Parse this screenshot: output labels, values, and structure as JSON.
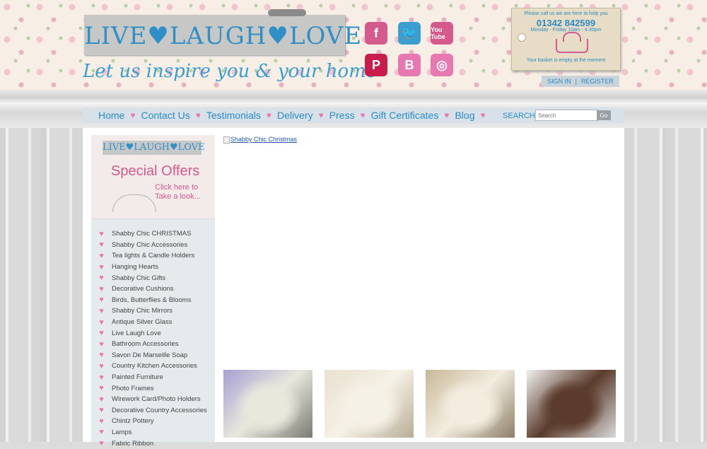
{
  "header": {
    "logo_text": "LIVE♥LAUGH♥LOVE",
    "tagline": "Let us inspire you & your home",
    "social": [
      {
        "name": "facebook-icon",
        "glyph": "f",
        "color": "#d45a8c"
      },
      {
        "name": "twitter-icon",
        "glyph": "🐦",
        "color": "#3a9fd0"
      },
      {
        "name": "youtube-icon",
        "glyph": "You Tube",
        "color": "#d45a8c"
      },
      {
        "name": "pinterest-icon",
        "glyph": "P",
        "color": "#c81d4a"
      },
      {
        "name": "blogger-icon",
        "glyph": "B",
        "color": "#e878b2"
      },
      {
        "name": "instagram-icon",
        "glyph": "◎",
        "color": "#e878b2"
      }
    ],
    "help_text": "Please call us we are here to help you",
    "phone": "01342 842599",
    "hours": "Monday - Friday 10am - 4.30pm",
    "basket_text": "Your basket is empty at the moment",
    "sign_in": "SIGN IN",
    "separator": "|",
    "register": "REGISTER"
  },
  "nav": {
    "items": [
      "Home",
      "Contact Us",
      "Testimonials",
      "Delivery",
      "Press",
      "Gift Certificates",
      "Blog"
    ],
    "search_label": "SEARCH",
    "search_placeholder": "Search",
    "go_label": "Go",
    "heart": "♥"
  },
  "sidebar": {
    "offer_logo": "LIVE♥LAUGH♥LOVE",
    "offer_title": "Special Offers",
    "offer_sub": "Click here to Take a look...",
    "categories": [
      "Shabby Chic CHRISTMAS",
      "Shabby Chic Accessories",
      "Tea lights & Candle Holders",
      "Hanging Hearts",
      "Shabby Chic Gifts",
      "Decorative Cushions",
      "Birds, Butterflies & Blooms",
      "Shabby Chic Mirrors",
      "Antique Silver Glass",
      "Live Laugh Love",
      "Bathroom Accessories",
      "Savon De Marseille Soap",
      "Country Kitchen Accessories",
      "Painted Furniture",
      "Photo Frames",
      "Wirework Card/Photo Holders",
      "Decorative Country Accessories",
      "Chintz Pottery",
      "Lamps",
      "Fabric Ribbon"
    ]
  },
  "main": {
    "banner_alt": "Shabby Chic Christmas",
    "thumbs": [
      {
        "name": "soap-thumbnail",
        "colors": [
          "#a79fd3",
          "#e9e8dd",
          "#7b7a72"
        ]
      },
      {
        "name": "lace-heart-thumbnail",
        "colors": [
          "#e9e1d0",
          "#f6f1e6",
          "#b8ad98"
        ]
      },
      {
        "name": "silver-jar-thumbnail",
        "colors": [
          "#c8b89a",
          "#f3ecdf",
          "#8d7f68"
        ]
      },
      {
        "name": "painted-table-thumbnail",
        "colors": [
          "#f1f1f1",
          "#5b3b2b",
          "#d9d9d9"
        ]
      }
    ]
  }
}
